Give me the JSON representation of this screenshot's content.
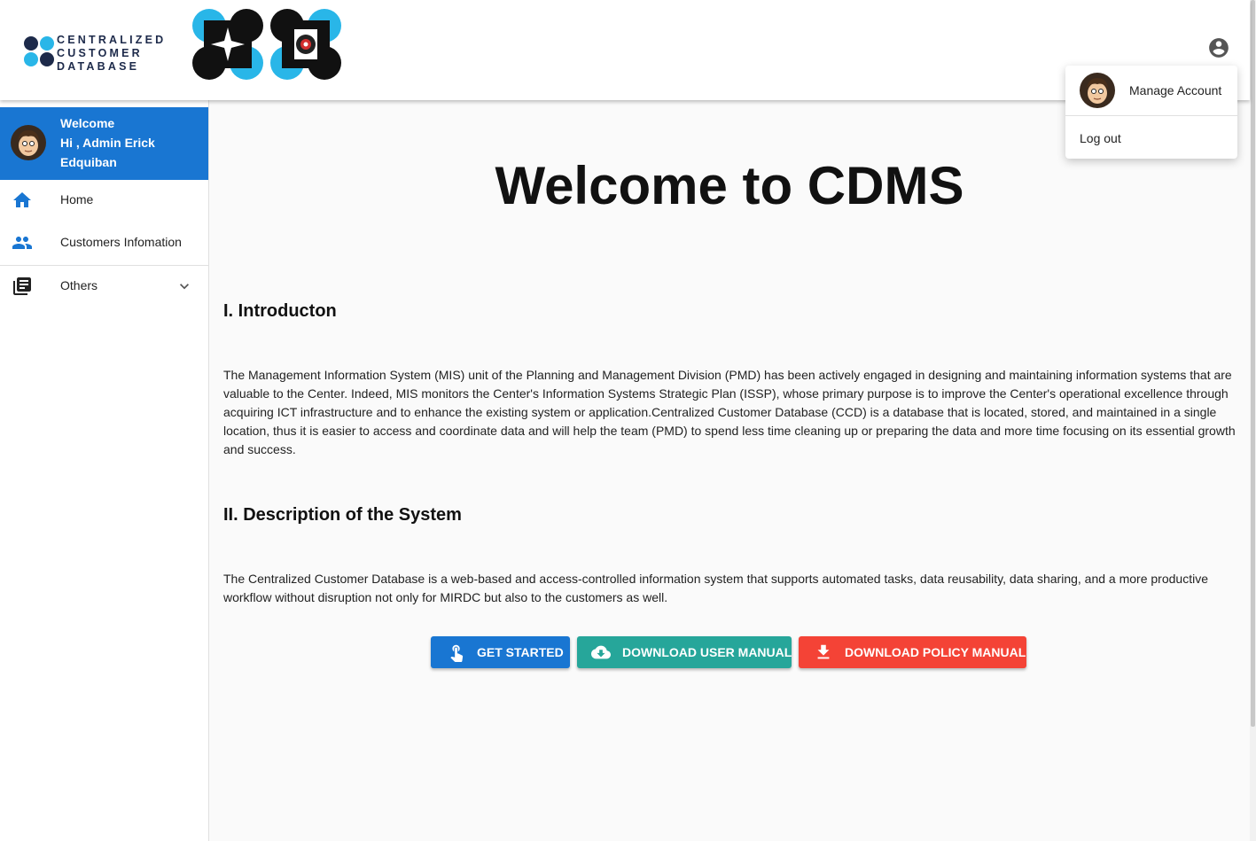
{
  "header": {
    "brand_lines": [
      "CENTRALIZED",
      "CUSTOMER",
      "DATABASE"
    ],
    "brand_icon": "ccd-logo-icon",
    "seal_icon": "agency-seal-icon",
    "account_icon": "account-circle-icon"
  },
  "account_menu": {
    "manage_label": "Manage Account",
    "logout_label": "Log out"
  },
  "sidebar": {
    "welcome": "Welcome",
    "greeting": "Hi , Admin Erick Edquiban",
    "items": [
      {
        "label": "Home",
        "icon": "home-icon"
      },
      {
        "label": "Customers Infomation",
        "icon": "people-icon"
      },
      {
        "label": "Others",
        "icon": "library-books-icon"
      }
    ]
  },
  "main": {
    "title": "Welcome to CDMS",
    "intro_heading": "I. Introducton",
    "intro_text": "The Management Information System (MIS) unit of the Planning and Management Division (PMD) has been actively engaged in designing and maintaining information systems that are valuable to the Center. Indeed, MIS monitors the Center's Information Systems Strategic Plan (ISSP), whose primary purpose is to improve the Center's operational excellence through acquiring ICT infrastructure and to enhance the existing system or application.Centralized Customer Database (CCD) is a database that is located, stored, and maintained in a single location, thus it is easier to access and coordinate data and will help the team (PMD) to spend less time cleaning up or preparing the data and more time focusing on its essential growth and success.",
    "desc_heading": "II. Description of the System",
    "desc_text": "The Centralized Customer Database is a web-based and access-controlled information system that supports automated tasks, data reusability, data sharing, and a more productive workflow without disruption not only for MIRDC but also to the customers as well.",
    "buttons": {
      "get_started": "GET STARTED",
      "user_manual": "DOWNLOAD USER MANUAL",
      "policy_manual": "DOWNLOAD POLICY MANUAL"
    }
  },
  "colors": {
    "primary": "#1976d2",
    "teal": "#26a69a",
    "red": "#f44336"
  }
}
